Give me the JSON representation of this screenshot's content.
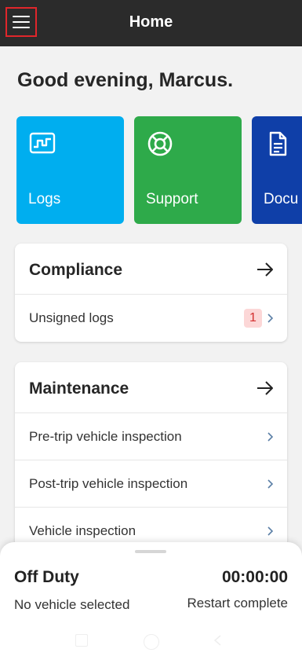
{
  "header": {
    "title": "Home",
    "menu_icon": "hamburger-menu-icon",
    "menu_highlight_color": "#e0262b"
  },
  "greeting": "Good evening, Marcus.",
  "tiles": [
    {
      "label": "Logs",
      "icon": "logs-chart-icon",
      "color": "#00aeef"
    },
    {
      "label": "Support",
      "icon": "lifebuoy-icon",
      "color": "#2eaa4a"
    },
    {
      "label": "Docu",
      "icon": "document-icon",
      "color": "#0f3fa8"
    }
  ],
  "compliance": {
    "title": "Compliance",
    "rows": [
      {
        "label": "Unsigned logs",
        "badge": "1"
      }
    ]
  },
  "maintenance": {
    "title": "Maintenance",
    "rows": [
      {
        "label": "Pre-trip vehicle inspection"
      },
      {
        "label": "Post-trip vehicle inspection"
      },
      {
        "label": "Vehicle inspection"
      }
    ]
  },
  "status_sheet": {
    "duty_status": "Off Duty",
    "timer": "00:00:00",
    "vehicle": "No vehicle selected",
    "restart": "Restart complete"
  },
  "colors": {
    "header_bg": "#2b2b2b",
    "badge_bg": "#fcd7d7",
    "badge_text": "#d32f2f",
    "chevron": "#5b7fa6"
  }
}
